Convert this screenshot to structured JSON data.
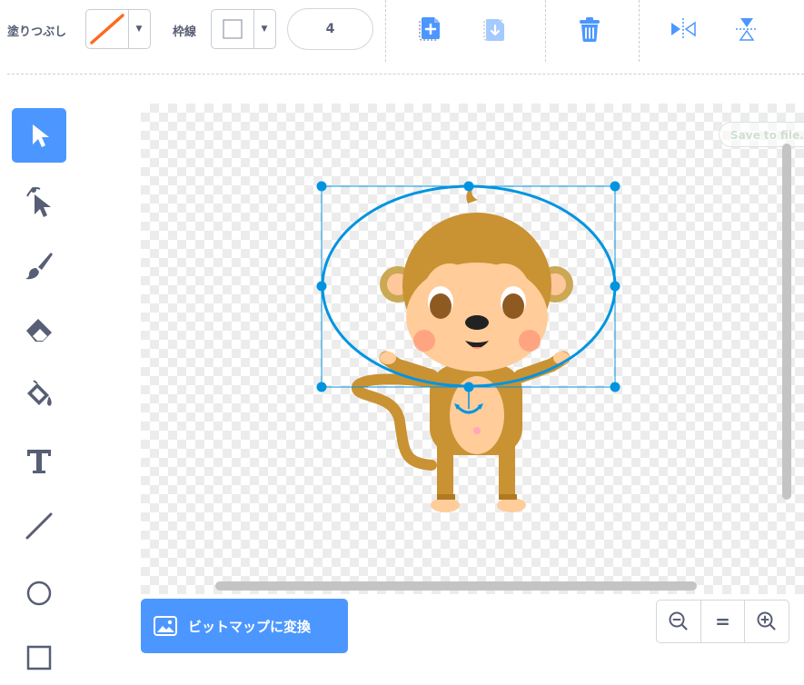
{
  "toolbar": {
    "fill_label": "塗りつぶし",
    "outline_label": "枠線",
    "stroke_width": "4",
    "fill_color": "#ff6a1e",
    "outline_color": "none",
    "icons": [
      "copy-icon",
      "paste-icon",
      "delete-icon",
      "flip-horizontal-icon",
      "flip-vertical-icon"
    ]
  },
  "tools": [
    {
      "name": "select-tool",
      "icon": "arrow-cursor-icon",
      "active": true
    },
    {
      "name": "reshape-tool",
      "icon": "reshape-icon",
      "active": false
    },
    {
      "name": "brush-tool",
      "icon": "brush-icon",
      "active": false
    },
    {
      "name": "eraser-tool",
      "icon": "eraser-icon",
      "active": false
    },
    {
      "name": "fill-tool",
      "icon": "paint-bucket-icon",
      "active": false
    },
    {
      "name": "text-tool",
      "icon": "text-icon",
      "active": false
    },
    {
      "name": "line-tool",
      "icon": "line-icon",
      "active": false
    },
    {
      "name": "circle-tool",
      "icon": "circle-icon",
      "active": false
    },
    {
      "name": "rectangle-tool",
      "icon": "rectangle-icon",
      "active": false
    }
  ],
  "canvas": {
    "hint_text": "Save to file...",
    "selection_color": "#0094e0"
  },
  "bottom": {
    "convert_button_label": "ビットマップに変換",
    "zoom_reset_label": "="
  },
  "colors": {
    "accent": "#4c97ff",
    "icon_gray": "#575e75"
  }
}
